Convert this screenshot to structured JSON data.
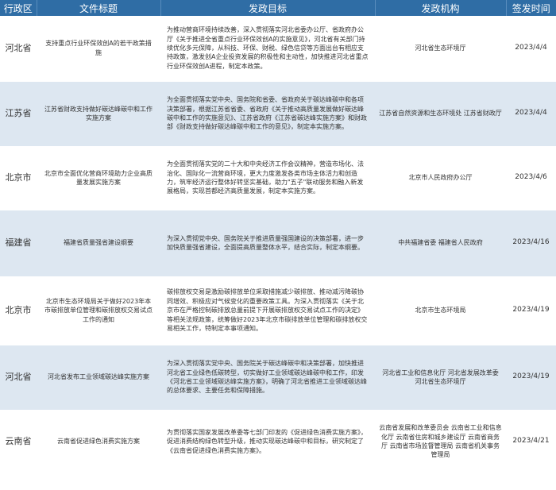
{
  "headers": [
    "行政区",
    "文件标题",
    "发政目标",
    "发政机构",
    "签发时间"
  ],
  "rows": [
    {
      "region": "河北省",
      "title": "支持重点行业环保效创A的若干政策措施",
      "goal": "为推动营商环境持续改善，深入贯彻落实河北省委办公厅、省政府办公厅《关于推进全省重点行业环保效创A的实施意见》，河北省有关部门持续优化多元保障，从科技、环保、财税、绿色信贷等方面出台有相应支持政策，激发创A企业投资发展的积极性和主动性，加快推进河北省重点行业环保效创A进程，制定本政策。",
      "org": "河北省生态环境厅",
      "date": "2023/4/4"
    },
    {
      "region": "江苏省",
      "title": "江苏省财政支持做好碳达峰碳中和工作实施方案",
      "goal": "为全面贯彻落实党中央、国务院和省委、省政府关于碳达峰碳中和各项决策部署，根据江苏省省委、省政府《关于推动高质量发展做好碳达峰碳中和工作的实施意见》、江苏省政府《江苏省碳达峰实施方案》和财政部《财政支持做好碳达峰碳中和工作的意见》，制定本实施方案。",
      "org": "江苏省自然资源和生态环境处 江苏省财政厅",
      "date": "2023/4/4"
    },
    {
      "region": "北京市",
      "title": "北京市全面优化营商环境助力企业高质量发展实施方案",
      "goal": "为全面贯彻落实党的二十大和中央经济工作会议精神，营造市场化、法治化、国际化一流营商环境，更大力度激发各类市场主体活力和创造力，筑牢经济运行整体好转坚实基础，助力\"五子\"联动服务和融入新发展格局，实现首都经济高质量发展，制定本实施方案。",
      "org": "北京市人民政府办公厅",
      "date": "2023/4/6"
    },
    {
      "region": "福建省",
      "title": "福建省质量强省建设纲要",
      "goal": "为深入贯彻党中央、国务院关于推进质量强国建设的决策部署，进一步加快质量强省建设，全面提高质量整体水平，结合实际，制定本纲要。",
      "org": "中共福建省委 福建省人民政府",
      "date": "2023/4/16"
    },
    {
      "region": "北京市",
      "title": "北京市生态环境局关于做好2023年本市碳排放单位管理和碳排放权交易试点工作的通知",
      "goal": "碳排放权交易是激励碳排放单位采取措施减少碳排放、推动减污降碳协同增效、积极应对气候变化的重要政策工具。为深入贯彻落实《关于北京市在严格控制碳排放总量前提下开展碳排放权交易试点工作的决定》等相关法规政策，统筹做好2023年北京市碳排放单位管理和碳排放权交易相关工作，特制定本事项通知。",
      "org": "北京市生态环境局",
      "date": "2023/4/19"
    },
    {
      "region": "河北省",
      "title": "河北省发布工业领域碳达峰实施方案",
      "goal": "为深入贯彻落实党中央、国务院关于碳达峰碳中和决策部署，加快推进河北省工业绿色低碳转型，切实做好工业领域碳达峰碳中和工作，印发《河北省工业领域碳达峰实施方案》，明确了河北省推进工业领域碳达峰的总体要求、主要任务和保障措施。",
      "org": "河北省工业和信息化厅 河北省发展改革委 河北省生态环境厅",
      "date": "2023/4/19"
    },
    {
      "region": "云南省",
      "title": "云南省促进绿色消费实施方案",
      "goal": "为贯彻落实国家发展改革委等七部门印发的《促进绿色消费实施方案》，促进消费结构绿色转型升级，推动实现碳达峰碳中和目标，研究制定了《云南省促进绿色消费实施方案》。",
      "org": "云南省发展和改革委员会 云南省工业和信息化厅 云南省住房和城乡建设厅 云南省商务厅 云南省市场监督管理局 云南省机关事务管理局",
      "date": "2023/4/21"
    }
  ]
}
